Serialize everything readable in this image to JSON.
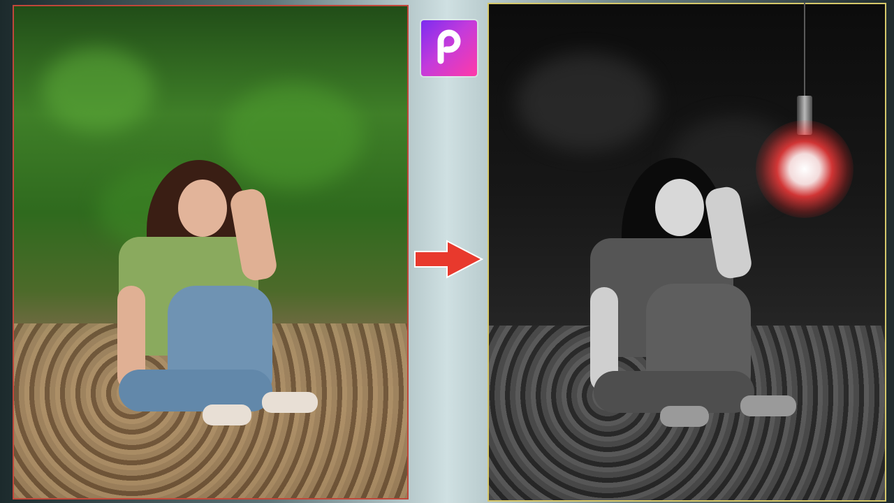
{
  "scene": {
    "before_label": "",
    "after_label": "",
    "logo_letter": "P"
  },
  "colors": {
    "before_border": "#c0473a",
    "after_border": "#d6c86a",
    "arrow": "#e8392d",
    "bulb_glow": "#ff3c3c"
  },
  "icons": {
    "logo": "picsart-logo-icon",
    "arrow": "right-arrow-icon",
    "bulb": "light-bulb-icon"
  }
}
